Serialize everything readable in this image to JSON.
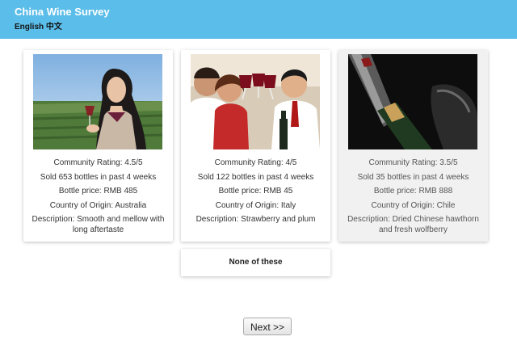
{
  "header": {
    "title": "China Wine Survey",
    "lang_english": "English",
    "lang_chinese": "中文",
    "background_color": "#5bbde9"
  },
  "wines": [
    {
      "image": "woman-tasting-red-wine-in-vineyard",
      "rating": "Community Rating: 4.5/5",
      "sold": "Sold 653 bottles in past 4 weeks",
      "price": "Bottle price: RMB 485",
      "origin": "Country of Origin: Australia",
      "description": "Description: Smooth and mellow with long aftertaste",
      "selected": false
    },
    {
      "image": "friends-toasting-red-wine",
      "rating": "Community Rating: 4/5",
      "sold": "Sold 122 bottles in past 4 weeks",
      "price": "Bottle price: RMB 45",
      "origin": "Country of Origin: Italy",
      "description": "Description: Strawberry and plum",
      "selected": false
    },
    {
      "image": "corkscrew-opening-wine-bottle",
      "rating": "Community Rating: 3.5/5",
      "sold": "Sold 35 bottles in past 4 weeks",
      "price": "Bottle price: RMB 888",
      "origin": "Country of Origin: Chile",
      "description": "Description: Dried Chinese hawthorn and fresh wolfberry",
      "selected": true
    }
  ],
  "none_option": "None of these",
  "next_button": "Next >>"
}
